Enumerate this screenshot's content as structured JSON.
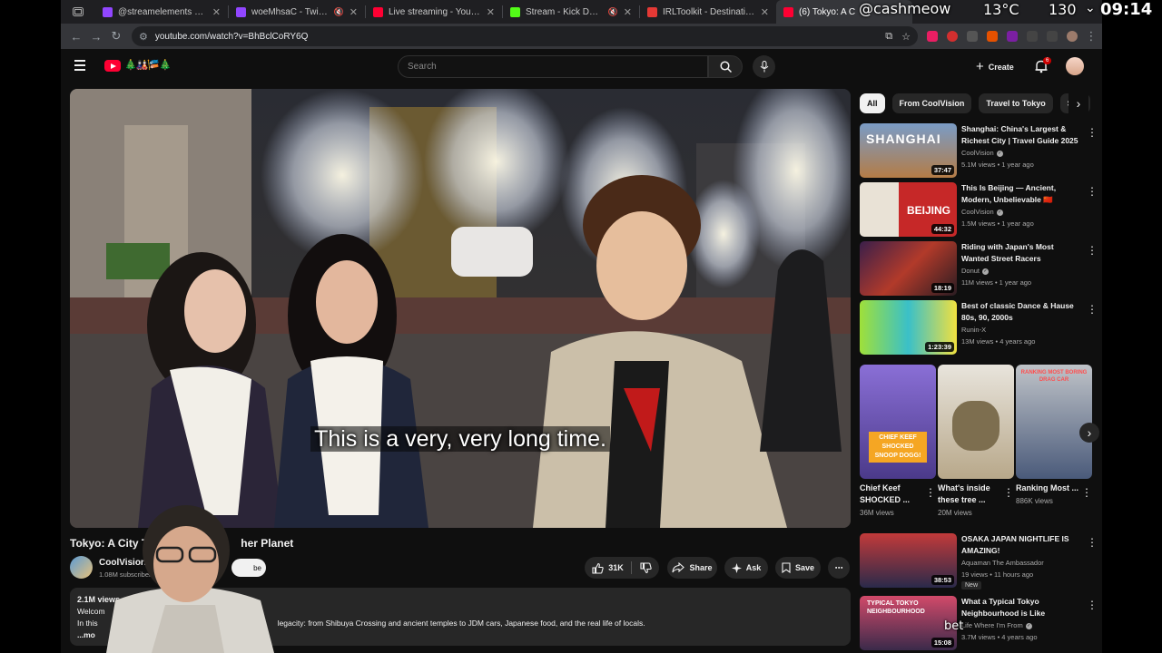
{
  "tabs": [
    {
      "label": "@streamelements mentio",
      "favicon_color": "#9146ff"
    },
    {
      "label": "woeMhsaC - Twitch",
      "favicon_color": "#9146ff"
    },
    {
      "label": "Live streaming - YouTube Stu",
      "favicon_color": "#ff0033"
    },
    {
      "label": "Stream - Kick Dashboard",
      "favicon_color": "#53fc18"
    },
    {
      "label": "IRLToolkit - Destinations",
      "favicon_color": "#e53935"
    },
    {
      "label": "(6) Tokyo: A C",
      "favicon_color": "#ff0033"
    }
  ],
  "address_bar": {
    "url": "youtube.com/watch?v=BhBclCoRY6Q"
  },
  "masthead": {
    "search_placeholder": "Search",
    "doodle": "🎄🎎🎏🎄",
    "create_label": "Create",
    "notification_count": "6"
  },
  "player": {
    "caption": "This is a very, very long time."
  },
  "video": {
    "title": "Tokyo: A City That",
    "title_tail": "her Planet",
    "channel_name": "CoolVision",
    "subscribers": "1.08M subscribers",
    "subscribe_label": "be",
    "likes": "31K",
    "share_label": "Share",
    "ask_label": "Ask",
    "save_label": "Save"
  },
  "description": {
    "views": "2.1M views",
    "line1": "Welcom",
    "line2_start": "In this",
    "line2_end": "legacity: from Shibuya Crossing and ancient temples to JDM cars, Japanese food, and the real life of locals.",
    "more": "...mo"
  },
  "chips": [
    "All",
    "From CoolVision",
    "Travel to Tokyo",
    "Stre"
  ],
  "recommendations": [
    {
      "title": "Shanghai: China's Largest & Richest City | Travel Guide 2025",
      "channel": "CoolVision",
      "verified": true,
      "meta": "5.1M views • 1 year ago",
      "duration": "37:47",
      "thumb_text": "SHANGHAI"
    },
    {
      "title": "This Is Beijing — Ancient, Modern, Unbelievable 🇨🇳",
      "channel": "CoolVision",
      "verified": true,
      "meta": "1.5M views • 1 year ago",
      "duration": "44:32",
      "thumb_text": "BEIJING"
    },
    {
      "title": "Riding with Japan's Most Wanted Street Racers",
      "channel": "Donut",
      "verified": true,
      "meta": "11M views • 1 year ago",
      "duration": "18:19",
      "thumb_text": ""
    },
    {
      "title": "Best of classic Dance & Hause 80s, 90, 2000s",
      "channel": "Runin-X",
      "verified": false,
      "meta": "13M views • 4 years ago",
      "duration": "1:23:39",
      "thumb_text": ""
    },
    {
      "title": "OSAKA JAPAN NIGHTLIFE IS AMAZING!",
      "channel": "Aquaman The Ambassador",
      "verified": false,
      "meta": "19 views • 11 hours ago",
      "duration": "38:53",
      "badge": "New",
      "thumb_text": ""
    },
    {
      "title": "What a Typical Tokyo Neighbourhood is Like",
      "channel": "Life Where I'm From",
      "verified": true,
      "meta": "3.7M views • 4 years ago",
      "duration": "15:08",
      "thumb_text": "TYPICAL TOKYO NEIGHBOURHOOD"
    }
  ],
  "shorts": [
    {
      "title": "Chief Keef SHOCKED ...",
      "views": "36M views",
      "thumb_text": "CHIEF KEEF SHOCKED SNOOP DOGG!"
    },
    {
      "title": "What's inside these tree ...",
      "views": "20M views",
      "thumb_text": ""
    },
    {
      "title": "Ranking Most ...",
      "views": "886K views",
      "thumb_text": "RANKING MOST BORING DRAG CAR"
    }
  ],
  "hud": {
    "username": "@cashmeow",
    "temperature": "13°C",
    "number": "130",
    "time": "09:14",
    "watermark": "bet"
  }
}
